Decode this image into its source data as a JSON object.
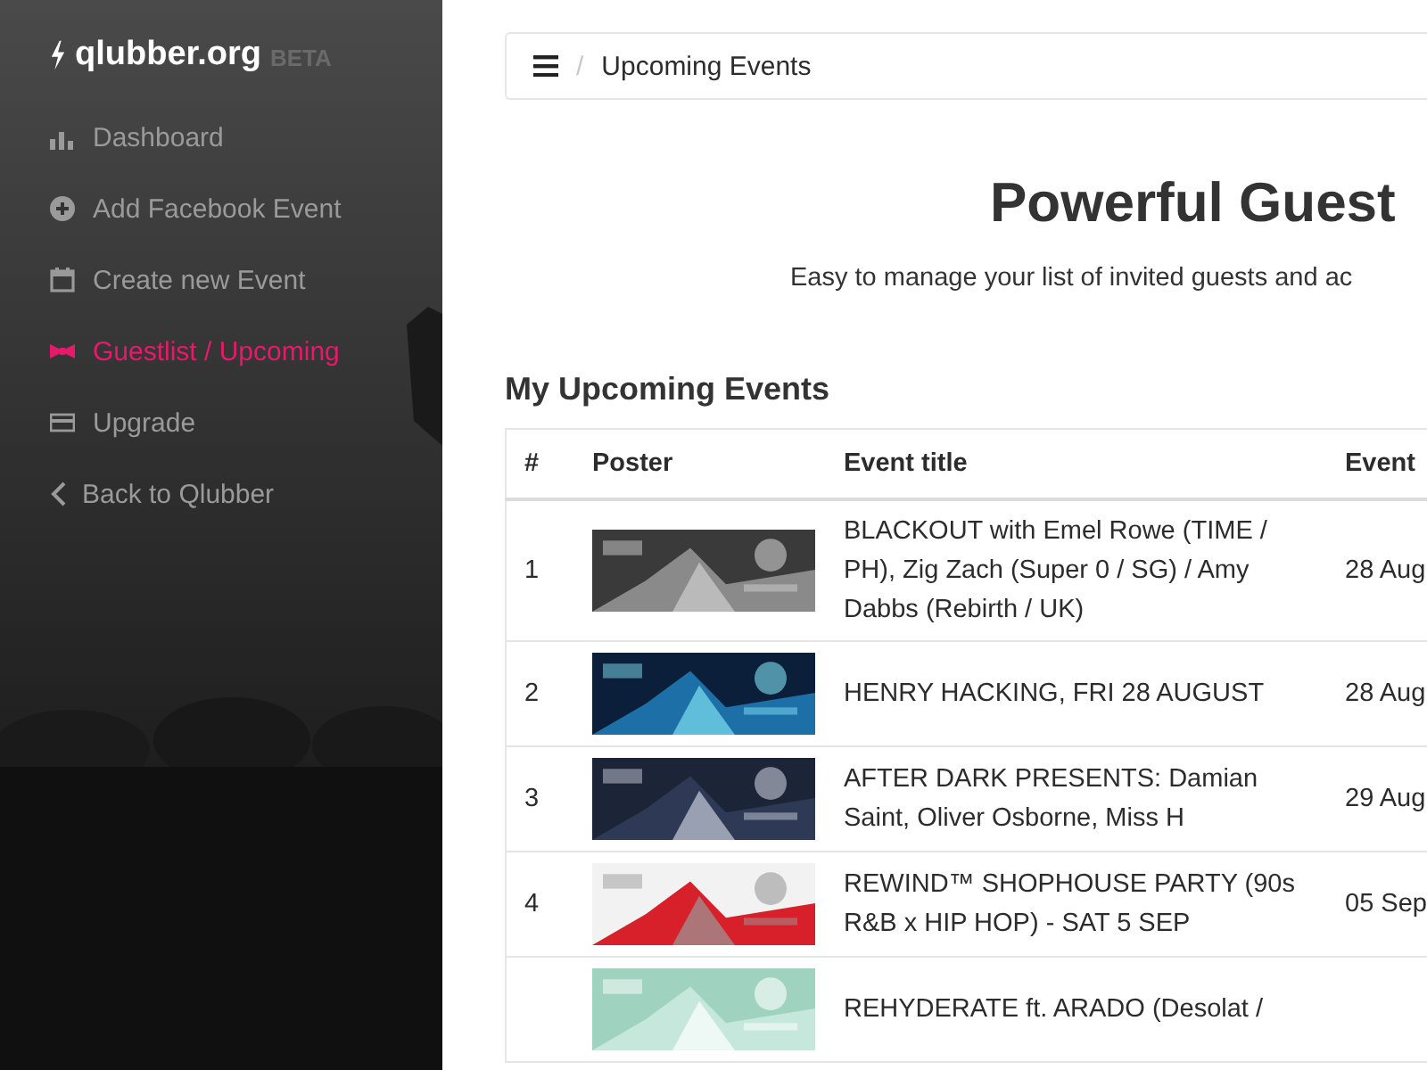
{
  "brand": {
    "logo": "qlubber.org",
    "badge": "BETA"
  },
  "sidebar": {
    "items": [
      {
        "label": "Dashboard",
        "kind": "chart",
        "selected": false
      },
      {
        "label": "Add Facebook Event",
        "kind": "plus",
        "selected": false
      },
      {
        "label": "Create new Event",
        "kind": "calendar",
        "selected": false
      },
      {
        "label": "Guestlist / Upcoming",
        "kind": "bowtie",
        "selected": true
      },
      {
        "label": "Upgrade",
        "kind": "card",
        "selected": false
      },
      {
        "label": "Back to Qlubber",
        "kind": "back",
        "selected": false
      }
    ]
  },
  "breadcrumb": {
    "separator": "/",
    "current": "Upcoming Events"
  },
  "hero": {
    "title": "Powerful Guest",
    "subtitle": "Easy to manage your list of invited guests and ac"
  },
  "section_title": "My Upcoming Events",
  "table": {
    "columns": [
      "#",
      "Poster",
      "Event title",
      "Event"
    ],
    "rows": [
      {
        "number": "1",
        "title": "BLACKOUT with Emel Rowe (TIME / PH), Zig Zach (Super 0 / SG) / Amy Dabbs (Rebirth / UK)",
        "date": "28 Aug"
      },
      {
        "number": "2",
        "title": "HENRY HACKING, FRI 28 AUGUST",
        "date": "28 Aug"
      },
      {
        "number": "3",
        "title": "AFTER DARK PRESENTS: Damian Saint, Oliver Osborne, Miss H",
        "date": "29 Aug"
      },
      {
        "number": "4",
        "title": "REWIND™ SHOPHOUSE PARTY (90s R&B x HIP HOP) - SAT 5 SEP",
        "date": "05 Sep"
      },
      {
        "title": "REHYDERATE ft. ARADO (Desolat /"
      }
    ]
  }
}
